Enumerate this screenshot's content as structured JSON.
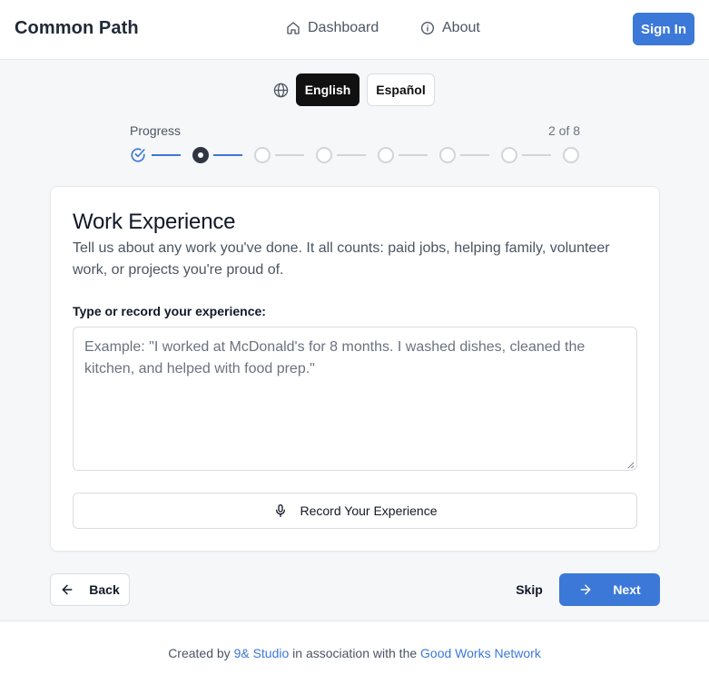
{
  "header": {
    "brand": "Common Path",
    "nav": [
      {
        "label": "Dashboard",
        "icon": "home-icon"
      },
      {
        "label": "About",
        "icon": "info-icon"
      }
    ],
    "signin_label": "Sign In",
    "accent_color": "#3b78d8"
  },
  "language": {
    "icon": "globe-icon",
    "options": [
      "English",
      "Español"
    ],
    "selected": "English"
  },
  "progress": {
    "label": "Progress",
    "count_text": "2 of 8",
    "current_step": 2,
    "total_steps": 8
  },
  "card": {
    "title": "Work Experience",
    "description": "Tell us about any work you've done. It all counts: paid jobs, helping family, volunteer work, or projects you're proud of.",
    "field_label": "Type or record your experience:",
    "textarea_value": "",
    "textarea_placeholder": "Example: \"I worked at McDonald's for 8 months. I washed dishes, cleaned the kitchen, and helped with food prep.\"",
    "record_label": "Record Your Experience",
    "record_icon": "microphone-icon"
  },
  "nav_buttons": {
    "back_label": "Back",
    "skip_label": "Skip",
    "next_label": "Next"
  },
  "footer": {
    "prefix": "Created by",
    "studio": "9& Studio",
    "middle": "in association with the",
    "network": "Good Works Network"
  }
}
